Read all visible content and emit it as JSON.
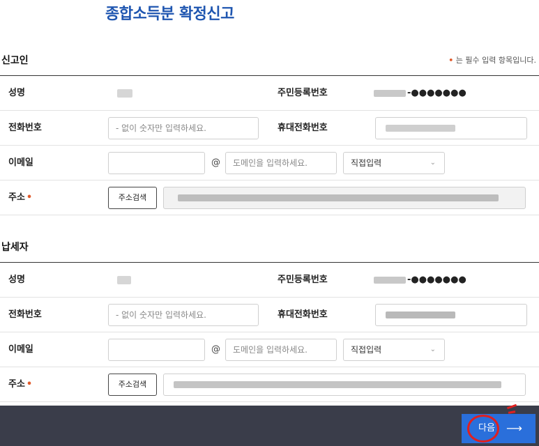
{
  "page": {
    "title": "종합소득분 확정신고"
  },
  "required_note": {
    "dot": "•",
    "text": " 는 필수 입력 항목입니다."
  },
  "reporter": {
    "section_title": "신고인",
    "name_label": "성명",
    "rrn_label": "주민등록번호",
    "rrn_suffix": "-●●●●●●●",
    "phone_label": "전화번호",
    "phone_placeholder": "- 없이 숫자만 입력하세요.",
    "mobile_label": "휴대전화번호",
    "email_label": "이메일",
    "email_at": "@",
    "domain_placeholder": "도메인을 입력하세요.",
    "domain_select": "직접입력",
    "address_label": "주소",
    "required_mark": "•",
    "address_button": "주소검색"
  },
  "taxpayer": {
    "section_title": "납세자",
    "name_label": "성명",
    "rrn_label": "주민등록번호",
    "rrn_suffix": "-●●●●●●●",
    "phone_label": "전화번호",
    "phone_placeholder": "- 없이 숫자만 입력하세요.",
    "mobile_label": "휴대전화번호",
    "email_label": "이메일",
    "email_at": "@",
    "domain_placeholder": "도메인을 입력하세요.",
    "domain_select": "직접입력",
    "address_label": "주소",
    "required_mark": "•",
    "address_button": "주소검색"
  },
  "footer": {
    "next_label": "다음",
    "next_arrow": "⟶"
  },
  "colors": {
    "title": "#1f56b0",
    "required": "#e05a2b",
    "primary_button": "#2a6fdb",
    "bottom_bar": "#3a3d4a",
    "annotation": "#e02020"
  },
  "icons": {
    "select_chevron": "chevron-down-icon",
    "next_arrow": "arrow-right-icon"
  }
}
